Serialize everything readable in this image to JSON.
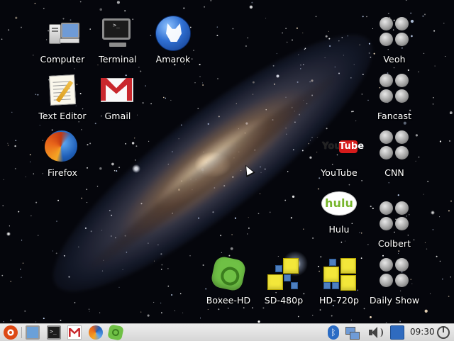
{
  "desktop": {
    "icons": [
      {
        "id": "computer",
        "label": "Computer",
        "icon": "computer-icon"
      },
      {
        "id": "terminal",
        "label": "Terminal",
        "icon": "terminal-icon",
        "prompt": ">_"
      },
      {
        "id": "amarok",
        "label": "Amarok",
        "icon": "amarok-wolf-icon"
      },
      {
        "id": "text_editor",
        "label": "Text Editor",
        "icon": "text-editor-icon"
      },
      {
        "id": "gmail",
        "label": "Gmail",
        "icon": "gmail-icon"
      },
      {
        "id": "firefox",
        "label": "Firefox",
        "icon": "firefox-icon"
      },
      {
        "id": "veoh",
        "label": "Veoh",
        "icon": "grey-dots-icon"
      },
      {
        "id": "fancast",
        "label": "Fancast",
        "icon": "grey-dots-icon"
      },
      {
        "id": "youtube",
        "label": "YouTube",
        "icon": "youtube-icon",
        "logo_you": "You",
        "logo_tube": "Tube"
      },
      {
        "id": "cnn",
        "label": "CNN",
        "icon": "grey-dots-icon"
      },
      {
        "id": "hulu",
        "label": "Hulu",
        "icon": "hulu-icon",
        "logo": "hulu"
      },
      {
        "id": "colbert",
        "label": "Colbert",
        "icon": "grey-dots-icon"
      },
      {
        "id": "boxee_hd",
        "label": "Boxee-HD",
        "icon": "boxee-icon"
      },
      {
        "id": "sd_480p",
        "label": "SD-480p",
        "icon": "sd-tiles-icon"
      },
      {
        "id": "hd_720p",
        "label": "HD-720p",
        "icon": "hd-tiles-icon"
      },
      {
        "id": "daily_show",
        "label": "Daily Show",
        "icon": "grey-dots-icon"
      }
    ]
  },
  "taskbar": {
    "launchers": [
      "ubuntu-menu-icon",
      "wallpaper-icon",
      "terminal-icon",
      "gmail-icon",
      "firefox-icon",
      "boxee-icon"
    ],
    "terminal_glyph": ">_",
    "bluetooth_glyph": "ᛒ",
    "tray": [
      "bluetooth-icon",
      "network-icon",
      "volume-icon",
      "calendar-icon"
    ],
    "clock": "09:30",
    "power": "power-icon"
  },
  "colors": {
    "taskbar_bg": "#e0e0e0",
    "ubuntu_orange": "#dd4814",
    "youtube_red": "#d61b1b",
    "hulu_green": "#77b52c",
    "boxee_green": "#6fc045",
    "tile_yellow": "#f3e73a"
  }
}
